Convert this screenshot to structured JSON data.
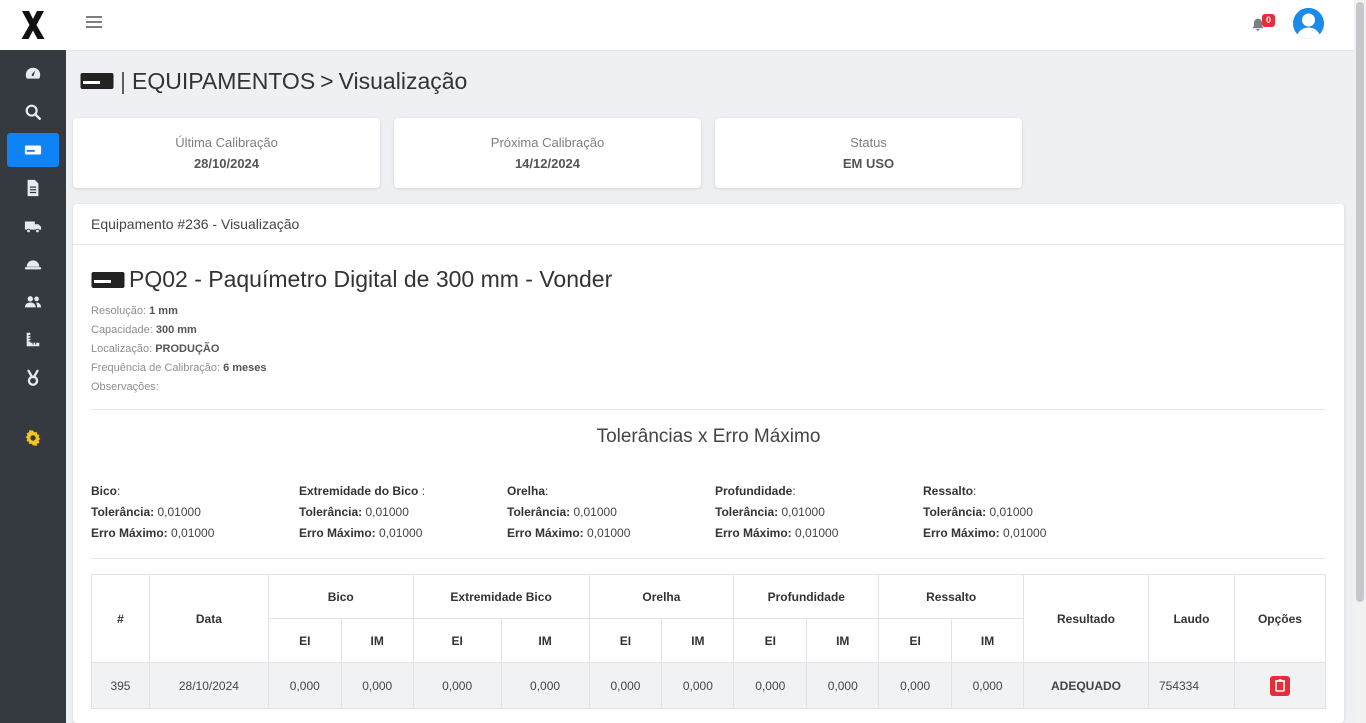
{
  "header": {
    "breadcrumb_section": "EQUIPAMENTOS",
    "breadcrumb_separator": ">",
    "breadcrumb_page": "Visualização",
    "notification_count": "0"
  },
  "sidebar": {
    "items": [
      {
        "icon": "dashboard-icon"
      },
      {
        "icon": "search-icon"
      },
      {
        "icon": "equipment-icon",
        "active": true
      },
      {
        "icon": "document-icon"
      },
      {
        "icon": "truck-icon"
      },
      {
        "icon": "helmet-icon"
      },
      {
        "icon": "users-icon"
      },
      {
        "icon": "ruler-icon"
      },
      {
        "icon": "tool-icon"
      },
      {
        "icon": "gear-icon"
      }
    ]
  },
  "cards": {
    "last_calibration_label": "Última Calibração",
    "last_calibration_value": "28/10/2024",
    "next_calibration_label": "Próxima Calibração",
    "next_calibration_value": "14/12/2024",
    "status_label": "Status",
    "status_value": "EM USO"
  },
  "equipment": {
    "card_header": "Equipamento #236 - Visualização",
    "title": "PQ02 - Paquímetro Digital de 300 mm - Vonder",
    "props": [
      {
        "label": "Resolução:",
        "value": "1 mm"
      },
      {
        "label": "Capacidade:",
        "value": "300 mm"
      },
      {
        "label": "Localização:",
        "value": "PRODUÇÃO"
      },
      {
        "label": "Frequência de Calibração:",
        "value": "6 meses"
      },
      {
        "label": "Observações:",
        "value": ""
      }
    ]
  },
  "tolerances": {
    "title": "Tolerâncias x Erro Máximo",
    "tolerance_label": "Tolerância:",
    "max_error_label": "Erro Máximo:",
    "items": [
      {
        "name": "Bico",
        "suffix": ":",
        "tolerance": "0,01000",
        "max_error": "0,01000"
      },
      {
        "name": "Extremidade do Bico",
        "suffix": " :",
        "tolerance": "0,01000",
        "max_error": "0,01000"
      },
      {
        "name": "Orelha",
        "suffix": ":",
        "tolerance": "0,01000",
        "max_error": "0,01000"
      },
      {
        "name": "Profundidade",
        "suffix": ":",
        "tolerance": "0,01000",
        "max_error": "0,01000"
      },
      {
        "name": "Ressalto",
        "suffix": ":",
        "tolerance": "0,01000",
        "max_error": "0,01000"
      }
    ]
  },
  "table": {
    "col_id": "#",
    "col_date": "Data",
    "groups": [
      "Bico",
      "Extremidade Bico",
      "Orelha",
      "Profundidade",
      "Ressalto"
    ],
    "sub_ei": "EI",
    "sub_im": "IM",
    "col_result": "Resultado",
    "col_report": "Laudo",
    "col_options": "Opções",
    "rows": [
      {
        "id": "395",
        "date": "28/10/2024",
        "values": [
          "0,000",
          "0,000",
          "0,000",
          "0,000",
          "0,000",
          "0,000",
          "0,000",
          "0,000",
          "0,000",
          "0,000"
        ],
        "result": "ADEQUADO",
        "report": "754334"
      }
    ]
  },
  "colors": {
    "primary": "#0d83f5",
    "sidebar": "#343a40",
    "success": "#1f9a3c",
    "danger": "#e52d3b",
    "gear": "#f5c518"
  }
}
